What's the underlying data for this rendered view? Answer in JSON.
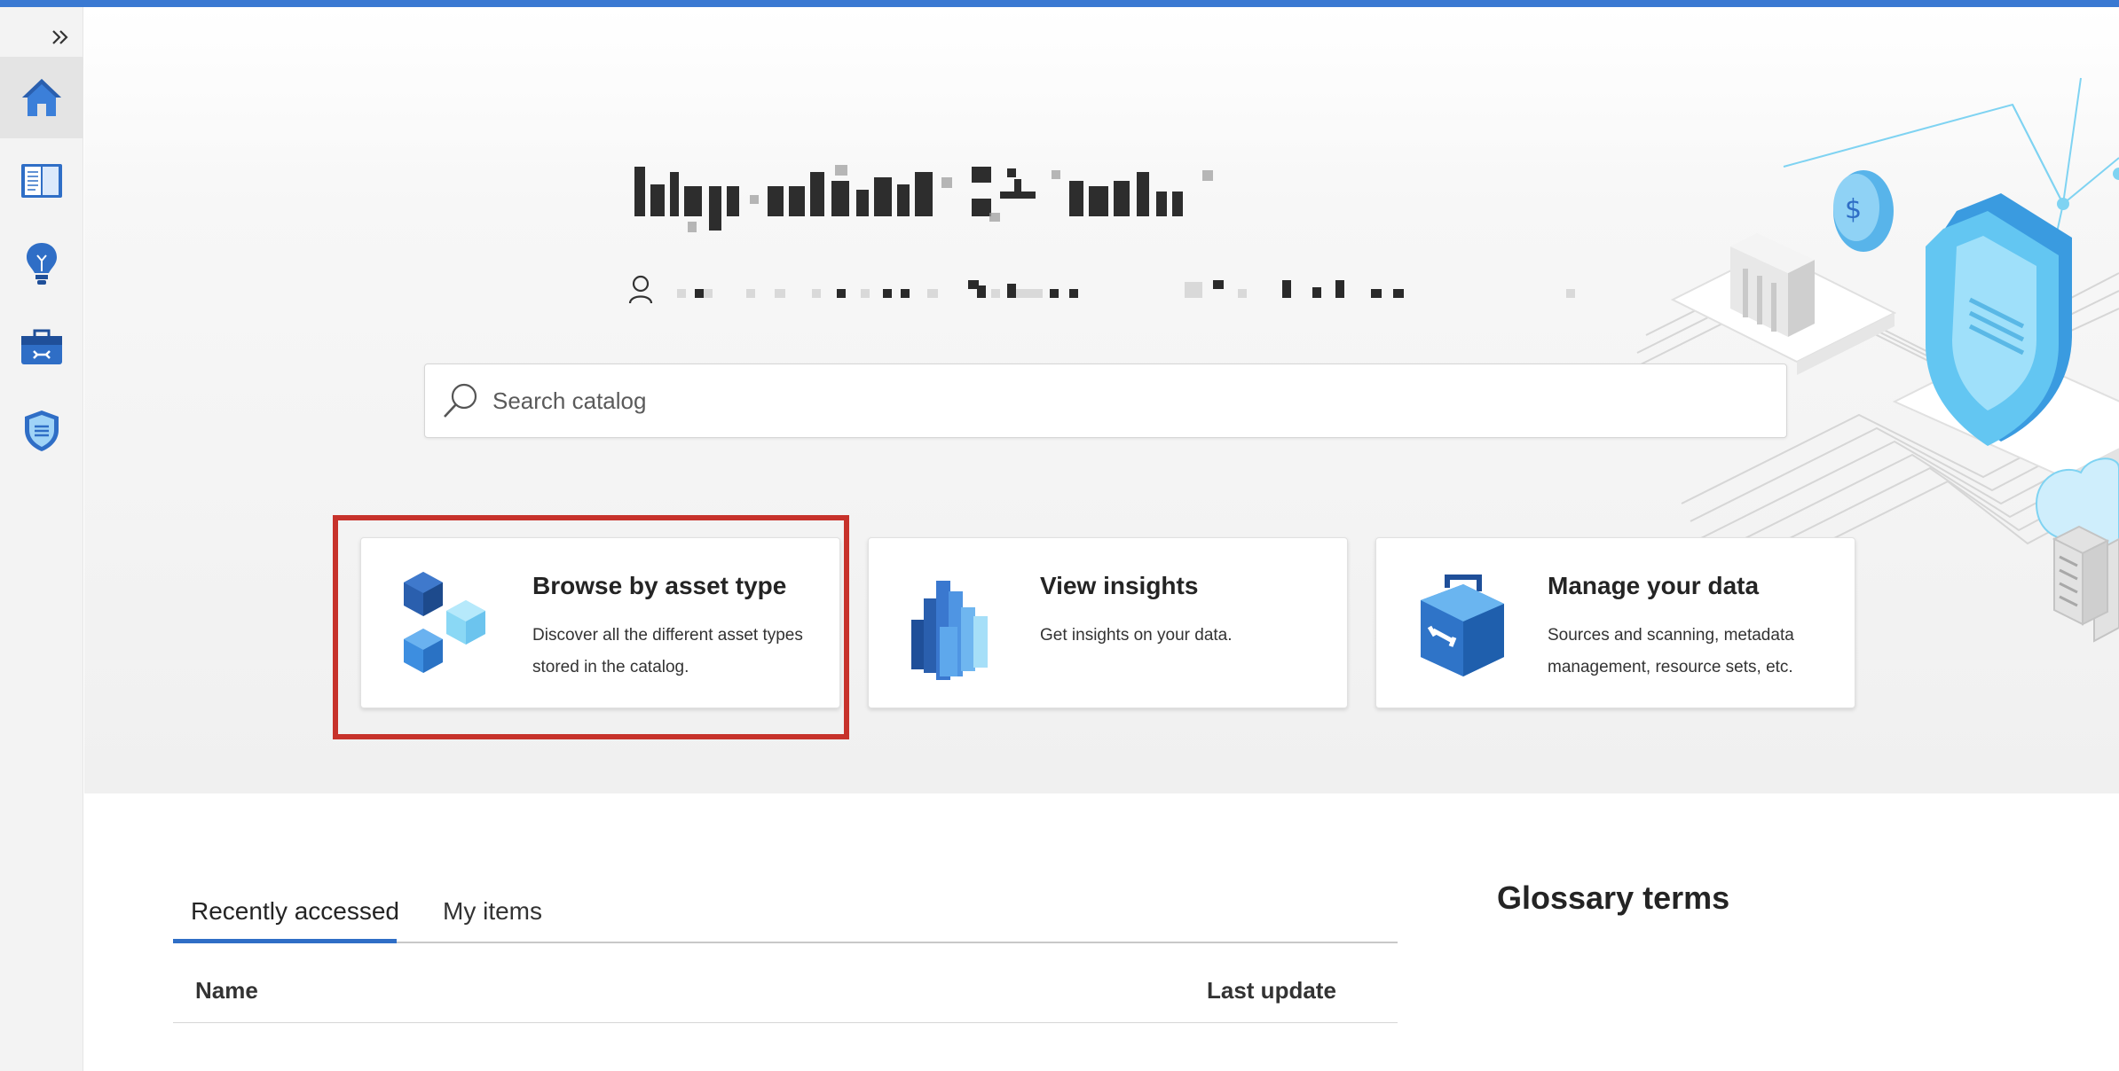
{
  "sidebar": {
    "expand_label": "Expand",
    "items": [
      {
        "icon": "home-icon",
        "active": true
      },
      {
        "icon": "book-icon",
        "active": false
      },
      {
        "icon": "lightbulb-icon",
        "active": false
      },
      {
        "icon": "toolbox-icon",
        "active": false
      },
      {
        "icon": "shield-icon",
        "active": false
      }
    ]
  },
  "search": {
    "placeholder": "Search catalog"
  },
  "cards": [
    {
      "title": "Browse by asset type",
      "description": "Discover all the different asset types stored in the catalog.",
      "highlighted": true
    },
    {
      "title": "View insights",
      "description": "Get insights on your data.",
      "highlighted": false
    },
    {
      "title": "Manage your data",
      "description": "Sources and scanning, metadata management, resource sets, etc.",
      "highlighted": false
    }
  ],
  "tabs": [
    {
      "label": "Recently accessed",
      "active": true
    },
    {
      "label": "My items",
      "active": false
    }
  ],
  "table": {
    "columns": [
      "Name",
      "Last update"
    ]
  },
  "glossary": {
    "title": "Glossary terms"
  },
  "colors": {
    "accent": "#2f6ec6",
    "top_bar": "#3a79d2",
    "highlight_border": "#c7322b"
  }
}
